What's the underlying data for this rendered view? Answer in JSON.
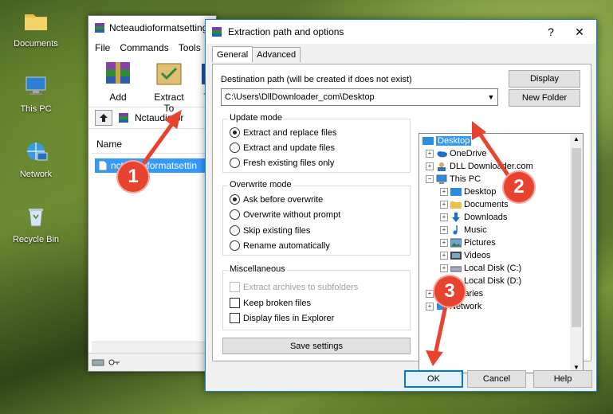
{
  "desktop": {
    "icons": [
      {
        "label": "Documents",
        "icon": "folder-icon"
      },
      {
        "label": "This PC",
        "icon": "computer-icon"
      },
      {
        "label": "Network",
        "icon": "network-icon"
      },
      {
        "label": "Recycle Bin",
        "icon": "recycle-bin-icon"
      }
    ]
  },
  "rar": {
    "title": "Ncteaudioformatsetting",
    "menu": [
      "File",
      "Commands",
      "Tools"
    ],
    "tools": [
      {
        "label": "Add",
        "icon": "add-archive-icon"
      },
      {
        "label": "Extract To",
        "icon": "extract-to-icon"
      },
      {
        "label": "T",
        "icon": "test-icon"
      }
    ],
    "address": "Nctaudiofor",
    "column_name": "Name",
    "file": "nctaudioformatsettin"
  },
  "dialog": {
    "title": "Extraction path and options",
    "help": "?",
    "close": "✕",
    "tabs": [
      "General",
      "Advanced"
    ],
    "dest_label": "Destination path (will be created if does not exist)",
    "dest_value": "C:\\Users\\DllDownloader_com\\Desktop",
    "display_btn": "Display",
    "new_folder_btn": "New Folder",
    "update_mode": {
      "title": "Update mode",
      "options": [
        "Extract and replace files",
        "Extract and update files",
        "Fresh existing files only"
      ],
      "selected": 0
    },
    "overwrite_mode": {
      "title": "Overwrite mode",
      "options": [
        "Ask before overwrite",
        "Overwrite without prompt",
        "Skip existing files",
        "Rename automatically"
      ],
      "selected": 0
    },
    "misc": {
      "title": "Miscellaneous",
      "options": [
        "Extract archives to subfolders",
        "Keep broken files",
        "Display files in Explorer"
      ]
    },
    "save_settings": "Save settings",
    "tree": {
      "root": "Desktop",
      "items": [
        "OneDrive",
        "DLL Downloader.com",
        "This PC",
        "Desktop",
        "Documents",
        "Downloads",
        "Music",
        "Pictures",
        "Videos",
        "Local Disk (C:)",
        "Local Disk (D:)",
        "Libraries",
        "Network"
      ]
    },
    "ok": "OK",
    "cancel": "Cancel",
    "help_btn": "Help"
  },
  "annotations": [
    "1",
    "2",
    "3"
  ],
  "colors": {
    "accent": "#0078d7",
    "selection": "#3399ff",
    "badge": "#e8432f"
  }
}
